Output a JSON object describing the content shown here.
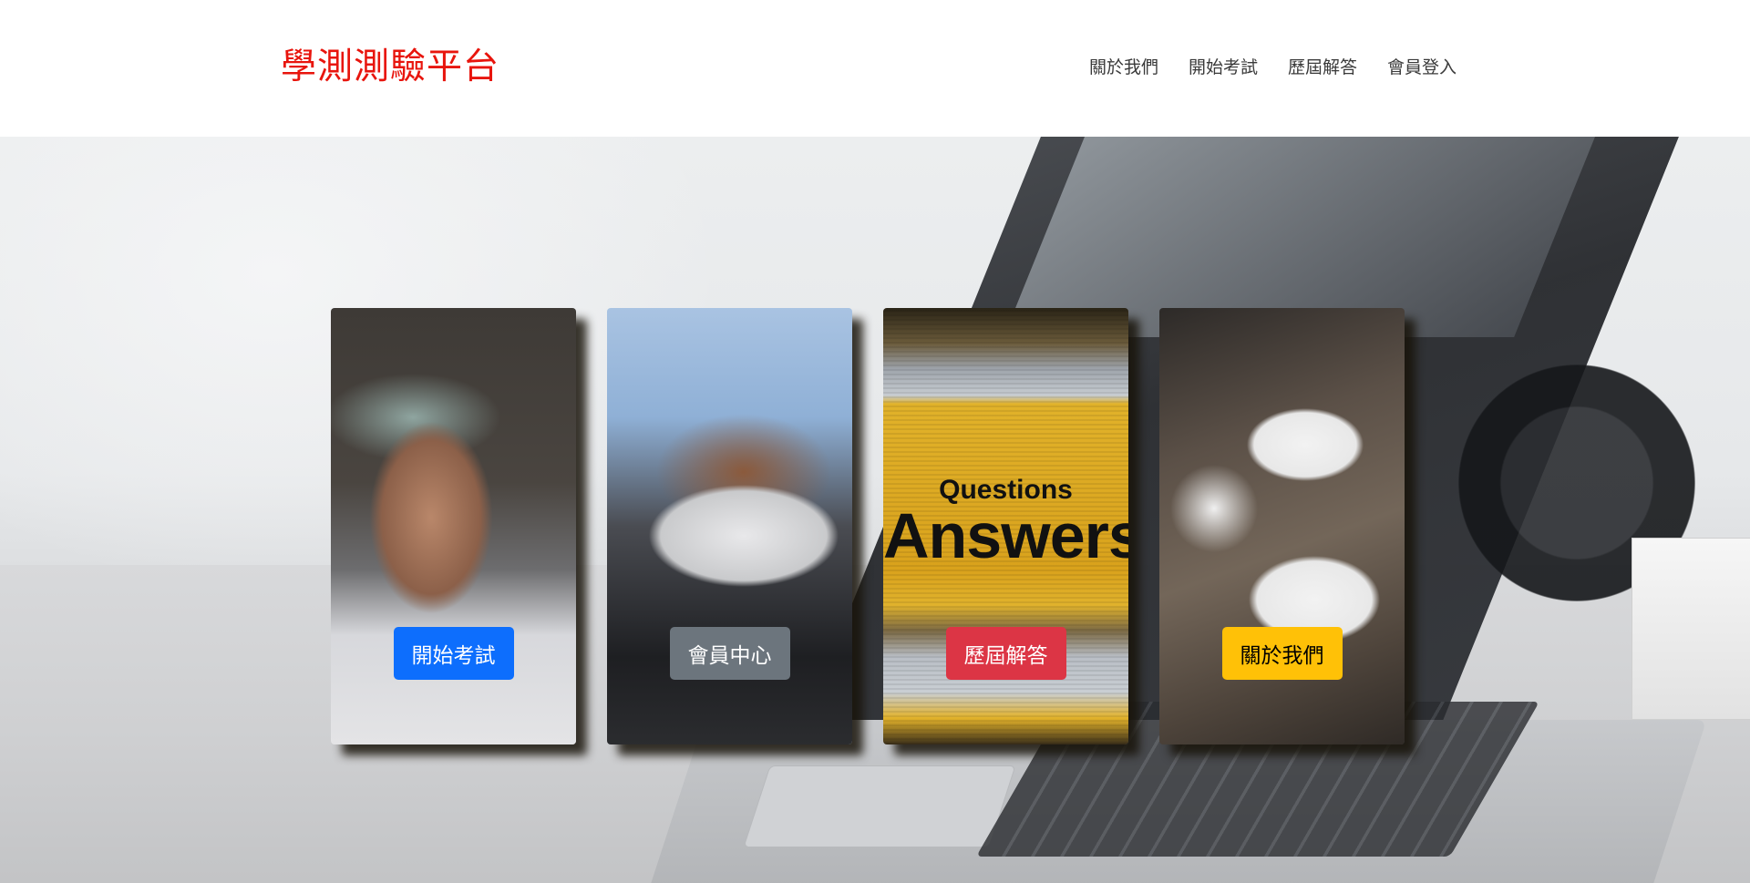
{
  "navbar": {
    "brand": "學測測驗平台",
    "links": [
      "關於我們",
      "開始考試",
      "歷屆解答",
      "會員登入"
    ]
  },
  "cards": [
    {
      "button": "開始考試",
      "style": "primary",
      "color": "#0d6efd",
      "image": "writing-hand-photo"
    },
    {
      "button": "會員中心",
      "style": "secondary",
      "color": "#6c757d",
      "image": "keyboard-typing-photo"
    },
    {
      "button": "歷屆解答",
      "style": "danger",
      "color": "#dc3545",
      "image": "questions-answers-sign-photo",
      "image_text": {
        "top": "Questions",
        "bottom": "Answers"
      }
    },
    {
      "button": "關於我們",
      "style": "warning",
      "color": "#ffc107",
      "image": "puzzle-teamwork-photo"
    }
  ],
  "colors": {
    "brand": "#e8150d",
    "nav_text": "#3a3a3a"
  },
  "hero_background": "laptop-on-desk-photo"
}
